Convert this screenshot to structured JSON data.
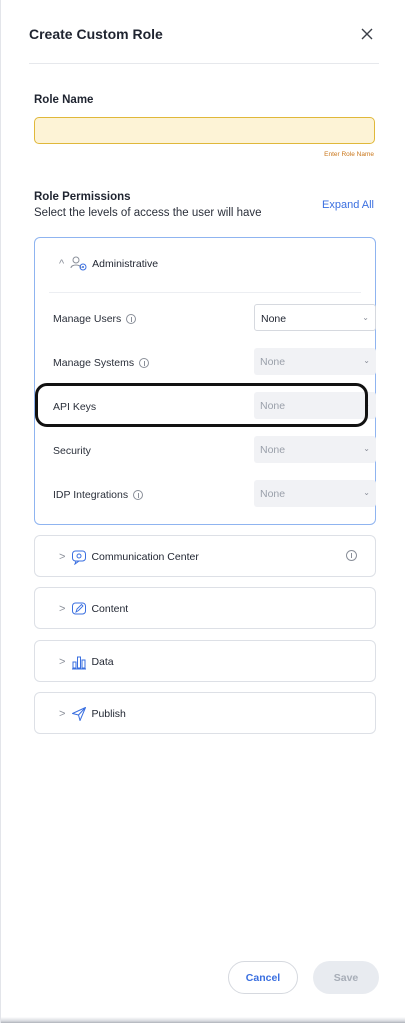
{
  "dialog": {
    "title": "Create Custom Role",
    "close_icon": "close-icon"
  },
  "role_name": {
    "label": "Role Name",
    "value": "",
    "placeholder": "",
    "hint": "Enter Role Name"
  },
  "permissions": {
    "heading": "Role Permissions",
    "subheading": "Select the levels of access the user will have",
    "expand_all": "Expand All",
    "groups": [
      {
        "label": "Administrative",
        "icon": "user-gear-icon",
        "expanded": true,
        "rows": [
          {
            "label": "Manage Users",
            "info": true,
            "value": "None",
            "enabled": true
          },
          {
            "label": "Manage Systems",
            "info": true,
            "value": "None",
            "enabled": false
          },
          {
            "label": "API Keys",
            "info": false,
            "value": "None",
            "enabled": false
          },
          {
            "label": "Security",
            "info": false,
            "value": "None",
            "enabled": false
          },
          {
            "label": "IDP Integrations",
            "info": true,
            "value": "None",
            "enabled": false
          }
        ]
      },
      {
        "label": "Communication Center",
        "icon": "chat-bubble-icon",
        "expanded": false,
        "info": true
      },
      {
        "label": "Content",
        "icon": "edit-icon",
        "expanded": false
      },
      {
        "label": "Data",
        "icon": "bar-chart-icon",
        "expanded": false
      },
      {
        "label": "Publish",
        "icon": "send-icon",
        "expanded": false
      }
    ]
  },
  "footer": {
    "cancel": "Cancel",
    "save": "Save"
  },
  "colors": {
    "accent": "#3a6fe0",
    "input_bg": "#fdf3d6",
    "input_border": "#e0b83a",
    "hint": "#c9761a"
  }
}
